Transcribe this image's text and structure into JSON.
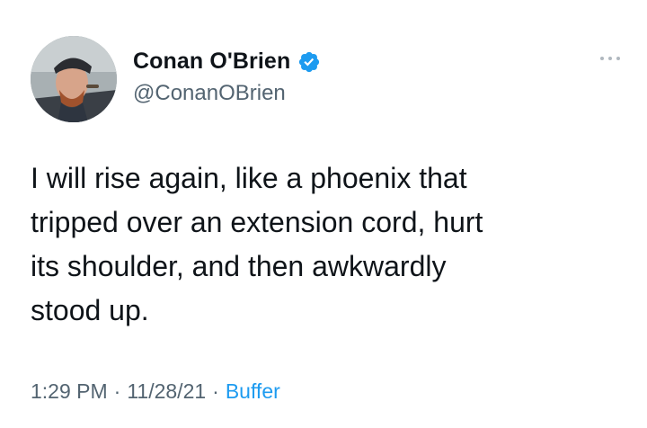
{
  "author": {
    "display_name": "Conan O'Brien",
    "handle": "@ConanOBrien",
    "verified": true
  },
  "tweet": {
    "text": "I will rise again, like a phoenix that\ntripped over an extension cord, hurt\nits shoulder, and then awkwardly\nstood up.",
    "time": "1:29 PM",
    "date": "11/28/21",
    "source": "Buffer",
    "separator": "·"
  },
  "colors": {
    "text": "#0f1419",
    "secondary": "#536471",
    "link": "#1d9bf0",
    "verified": "#1d9bf0"
  },
  "icons": {
    "verified": "verified-badge-icon",
    "more": "more-options-icon"
  }
}
